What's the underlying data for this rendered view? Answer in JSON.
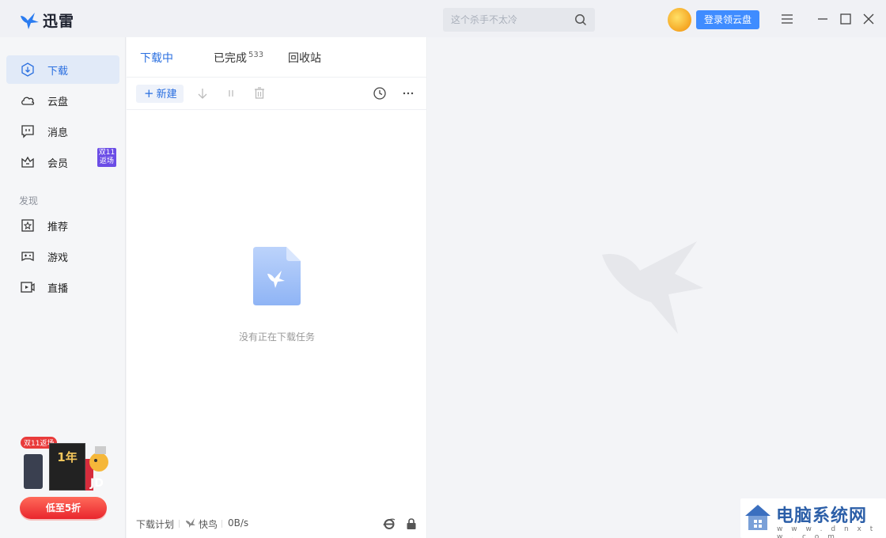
{
  "app": {
    "title": "迅雷"
  },
  "search": {
    "placeholder": "这个杀手不太冷"
  },
  "header": {
    "login_button": "登录领云盘"
  },
  "sidebar": {
    "items": [
      {
        "label": "下载",
        "icon": "download-icon"
      },
      {
        "label": "云盘",
        "icon": "cloud-icon"
      },
      {
        "label": "消息",
        "icon": "message-icon"
      },
      {
        "label": "会员",
        "icon": "crown-icon",
        "badge": [
          "双11",
          "返场"
        ]
      }
    ],
    "section_label": "发现",
    "discover_items": [
      {
        "label": "推荐",
        "icon": "star-icon"
      },
      {
        "label": "游戏",
        "icon": "gamepad-icon"
      },
      {
        "label": "直播",
        "icon": "live-icon"
      }
    ],
    "promo": {
      "tag": "双11返场",
      "box_text": "1年",
      "button": "低至5折"
    }
  },
  "main": {
    "tabs": [
      {
        "label": "下载中",
        "active": true
      },
      {
        "label": "已完成",
        "count": "533"
      },
      {
        "label": "回收站"
      }
    ],
    "toolbar": {
      "new_label": "新建"
    },
    "empty_text": "没有正在下载任务",
    "status": {
      "plan": "下载计划",
      "mode": "快鸟",
      "speed": "0B/s"
    }
  },
  "watermark": {
    "title": "电脑系统网",
    "url": "w w w . d n x t w . c o m"
  },
  "colors": {
    "accent": "#2a6fe0",
    "button": "#3f8cff",
    "badge": "#6b4de6"
  }
}
